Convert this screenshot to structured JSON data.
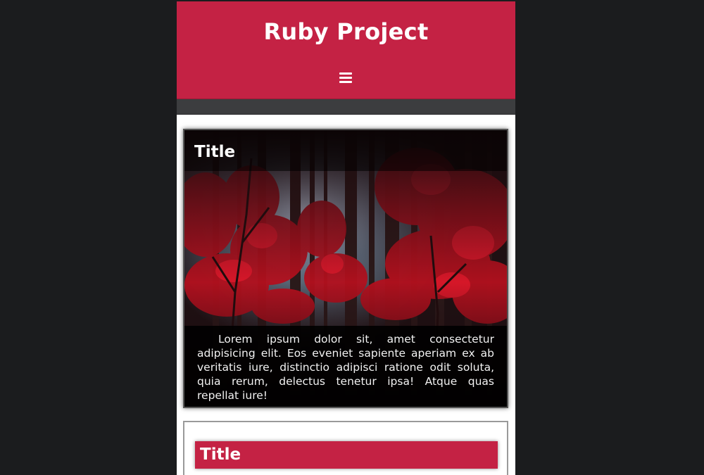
{
  "header": {
    "title": "Ruby Project",
    "menu_icon": "hamburger-menu-icon"
  },
  "cards": [
    {
      "title": "Title",
      "image": "red-autumn-forest-photo",
      "text": "Lorem ipsum dolor sit, amet consectetur adipisicing elit. Eos eveniet sapiente aperiam ex ab veritatis iure, distinctio adipisci ratione odit soluta, quia rerum, delectus tenetur ipsa! Atque quas repellat iure!"
    },
    {
      "title": "Title"
    }
  ],
  "colors": {
    "accent": "#c42244",
    "page_background": "#1b1c1e",
    "nav_bar": "#3c3d3f"
  }
}
